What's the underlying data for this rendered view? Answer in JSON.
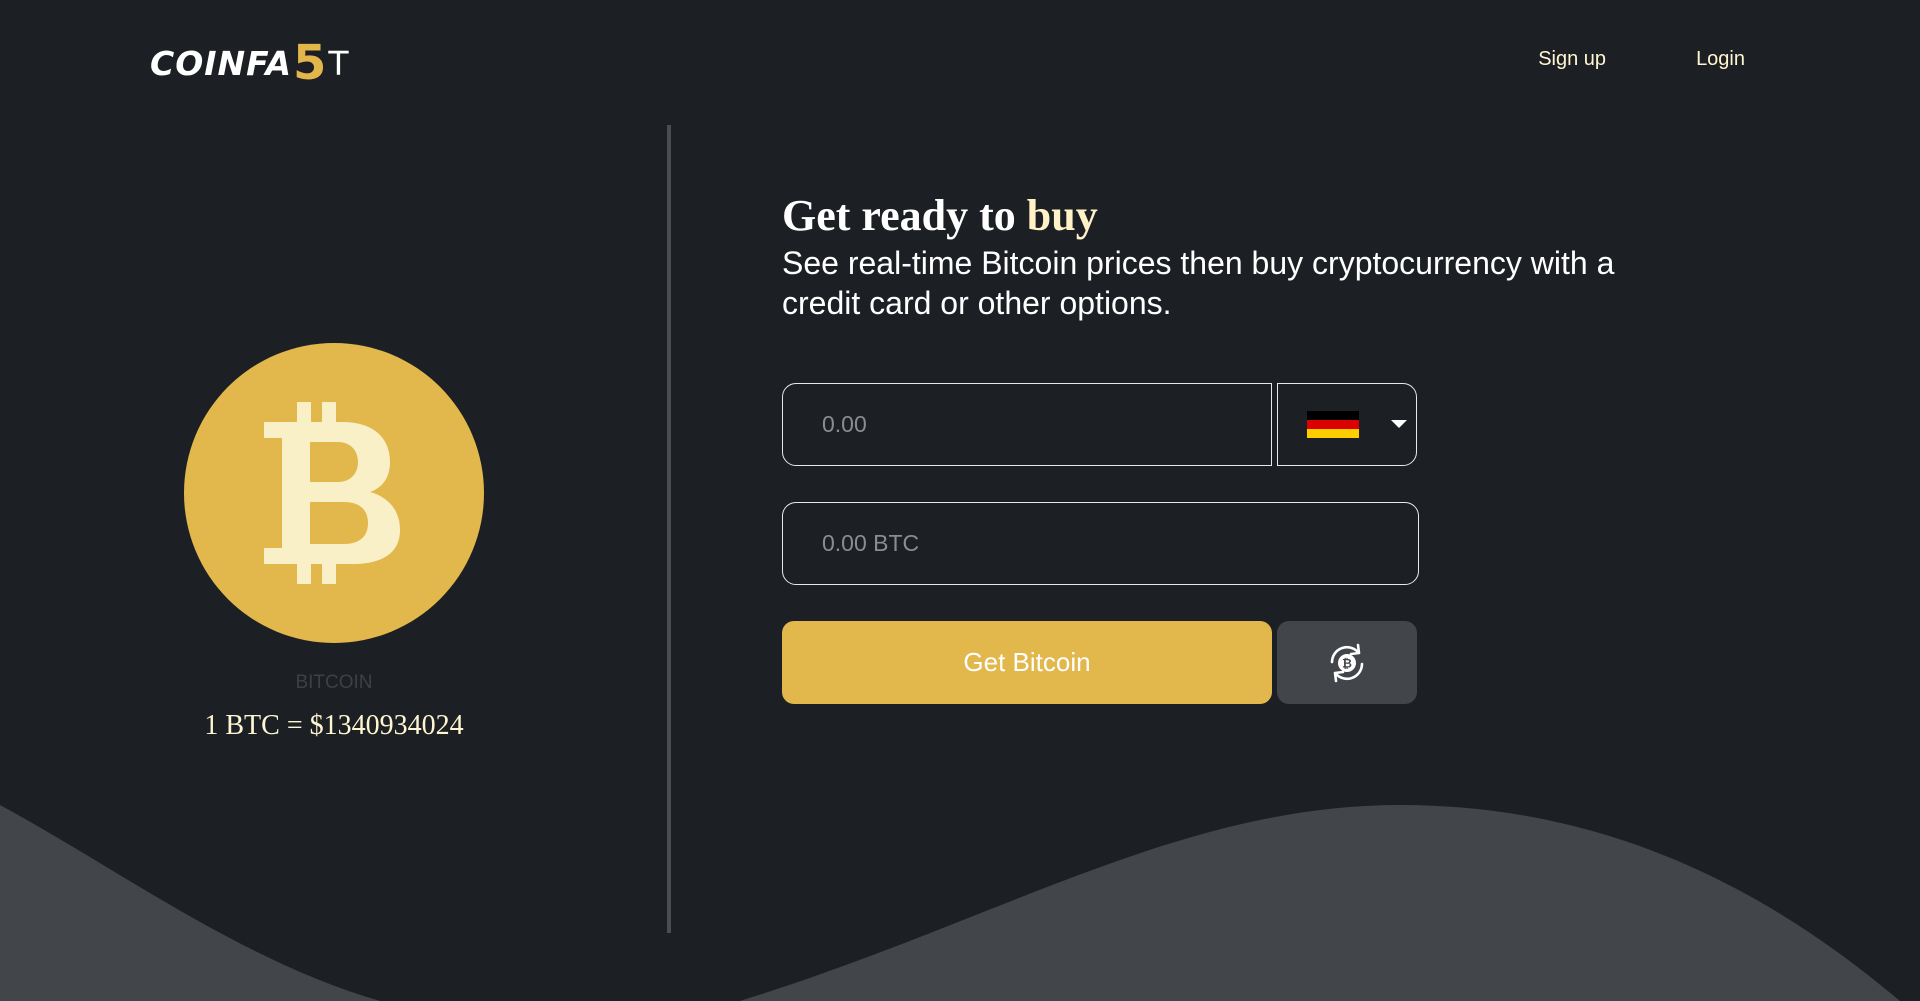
{
  "header": {
    "logo": {
      "part1": "COINFA",
      "part2": "5",
      "part3": "T"
    },
    "nav": {
      "signup_label": "Sign up",
      "login_label": "Login"
    }
  },
  "coin_panel": {
    "icon": "bitcoin-icon",
    "name": "BITCOIN",
    "price_text": "1 BTC = $1340934024"
  },
  "purchase": {
    "heading_prefix": "Get ready to",
    "heading_accent": "buy",
    "subheading": "See real-time Bitcoin prices then buy cryptocurrency with a credit card or other options.",
    "fiat_amount": {
      "value": "",
      "placeholder": "0.00"
    },
    "currency_select": {
      "selected_icon": "germany-flag-icon",
      "dropdown_icon": "caret-down-icon"
    },
    "btc_amount": {
      "value": "",
      "placeholder": "0.00 BTC"
    },
    "get_button_label": "Get Bitcoin",
    "swap_button_icon": "bitcoin-exchange-icon"
  },
  "colors": {
    "background": "#1c2024",
    "wave": "#42464a",
    "accent": "#e2b84c",
    "accent_light": "#fff6d1"
  }
}
